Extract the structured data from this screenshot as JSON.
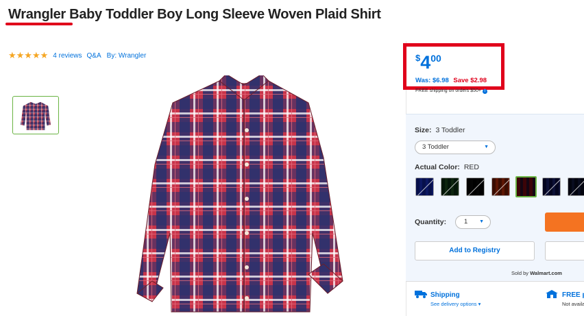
{
  "product": {
    "title": "Wrangler Baby Toddler Boy Long Sleeve Woven Plaid Shirt",
    "rating_stars": "★★★★★",
    "reviews": "4 reviews",
    "qa": "Q&A",
    "by": "By: Wrangler"
  },
  "price": {
    "currency": "$",
    "dollars": "4",
    "cents": "00",
    "was": "Was: $6.98",
    "save": "Save $2.98",
    "free_shipping": "FREE shipping on orders $50+"
  },
  "options": {
    "size_label": "Size:",
    "size_value": "3 Toddler",
    "size_select": "3 Toddler",
    "color_label": "Actual Color:",
    "color_value": "RED",
    "swatches": [
      {
        "name": "blue-plaid",
        "colors": [
          "#2b3f8a",
          "#4a5fb5"
        ]
      },
      {
        "name": "green-plaid",
        "colors": [
          "#1f4a2f",
          "#6b7d4a"
        ]
      },
      {
        "name": "black-plaid",
        "colors": [
          "#111111",
          "#444444"
        ]
      },
      {
        "name": "brown-plaid",
        "colors": [
          "#7a3a12",
          "#c0612b"
        ]
      },
      {
        "name": "red-plaid",
        "colors": [
          "#7b1e2d",
          "#2c2f6b"
        ]
      },
      {
        "name": "navy-plaid",
        "colors": [
          "#1b2559",
          "#6d6f9a"
        ]
      },
      {
        "name": "dark-plaid",
        "colors": [
          "#1a1f3d",
          "#5a6180"
        ]
      }
    ],
    "quantity_label": "Quantity:",
    "quantity_value": "1"
  },
  "actions": {
    "registry": "Add to Registry",
    "sold_by_prefix": "Sold by",
    "sold_by": "Walmart.com"
  },
  "fulfillment": {
    "shipping_title": "Shipping",
    "shipping_sub": "See delivery options ▾",
    "pickup_title": "FREE pickup",
    "pickup_sub": "Not available"
  },
  "colors": {
    "accent": "#0071dc",
    "alert": "#e0001b",
    "cta": "#f47321",
    "selected": "#69b342"
  }
}
